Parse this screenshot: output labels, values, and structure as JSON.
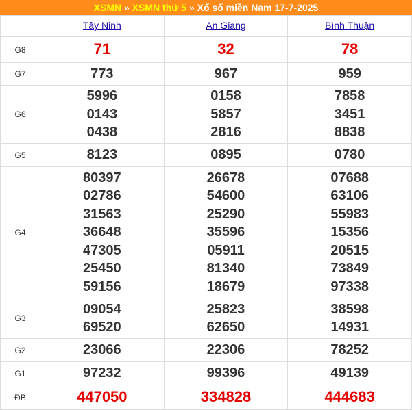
{
  "title": {
    "link1": "XSMN",
    "sep1": "»",
    "link2": "XSMN thứ 5",
    "sep2": "»",
    "text": "Xổ số miền Nam 17-7-2025"
  },
  "colors": {
    "header_bg": "#ff8c1a",
    "link_yellow": "#ffff00",
    "red": "#e60000",
    "province_link": "#1a0dab"
  },
  "provinces": [
    "Tây Ninh",
    "An Giang",
    "Bình Thuận"
  ],
  "prizes": [
    {
      "label": "G8",
      "values": [
        [
          "71"
        ],
        [
          "32"
        ],
        [
          "78"
        ]
      ]
    },
    {
      "label": "G7",
      "values": [
        [
          "773"
        ],
        [
          "967"
        ],
        [
          "959"
        ]
      ]
    },
    {
      "label": "G6",
      "values": [
        [
          "5996",
          "0143",
          "0438"
        ],
        [
          "0158",
          "5857",
          "2816"
        ],
        [
          "7858",
          "3451",
          "8838"
        ]
      ]
    },
    {
      "label": "G5",
      "values": [
        [
          "8123"
        ],
        [
          "0895"
        ],
        [
          "0780"
        ]
      ]
    },
    {
      "label": "G4",
      "values": [
        [
          "80397",
          "02786",
          "31563",
          "36648",
          "47305",
          "25450",
          "59156"
        ],
        [
          "26678",
          "54600",
          "25290",
          "35596",
          "05911",
          "81340",
          "18679"
        ],
        [
          "07688",
          "63106",
          "55983",
          "15356",
          "20515",
          "73849",
          "97338"
        ]
      ]
    },
    {
      "label": "G3",
      "values": [
        [
          "09054",
          "69520"
        ],
        [
          "25823",
          "62650"
        ],
        [
          "38598",
          "14931"
        ]
      ]
    },
    {
      "label": "G2",
      "values": [
        [
          "23066"
        ],
        [
          "22306"
        ],
        [
          "78252"
        ]
      ]
    },
    {
      "label": "G1",
      "values": [
        [
          "97232"
        ],
        [
          "99396"
        ],
        [
          "49139"
        ]
      ]
    },
    {
      "label": "ĐB",
      "values": [
        [
          "447050"
        ],
        [
          "334828"
        ],
        [
          "444683"
        ]
      ]
    }
  ]
}
